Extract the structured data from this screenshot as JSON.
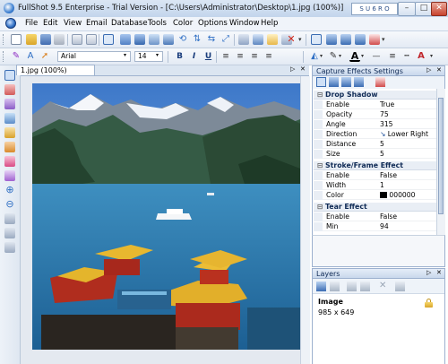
{
  "window": {
    "title": "FullShot 9.5 Enterprise - Trial Version - [C:\\Users\\Administrator\\Desktop\\1.jpg (100%)]",
    "controls": {
      "sys_box": "S U 6 R O",
      "minimize": "–",
      "maximize": "□",
      "close": "✕"
    }
  },
  "menu": [
    "File",
    "Edit",
    "View",
    "Email",
    "Database",
    "Tools",
    "Color",
    "Options",
    "Window",
    "Help"
  ],
  "format_bar": {
    "font": "Arial",
    "size": "14",
    "bold": "B",
    "italic": "I",
    "underline": "U"
  },
  "document": {
    "tab_label": "1.jpg (100%)",
    "pin": "▷",
    "close": "✕"
  },
  "capture_effects": {
    "title": "Capture Effects Settings",
    "pin": "▷",
    "close": "✕",
    "groups": [
      {
        "toggle": "⊟",
        "name": "Drop Shadow",
        "rows": [
          {
            "name": "Enable",
            "value": "True"
          },
          {
            "name": "Opacity",
            "value": "75"
          },
          {
            "name": "Angle",
            "value": "315"
          },
          {
            "name": "Direction",
            "value": "Lower Right",
            "icon": "↘"
          },
          {
            "name": "Distance",
            "value": "5"
          },
          {
            "name": "Size",
            "value": "5"
          }
        ]
      },
      {
        "toggle": "⊟",
        "name": "Stroke/Frame Effect",
        "rows": [
          {
            "name": "Enable",
            "value": "False"
          },
          {
            "name": "Width",
            "value": "1"
          },
          {
            "name": "Color",
            "value": "000000",
            "swatch": "#000000"
          }
        ]
      },
      {
        "toggle": "⊟",
        "name": "Tear Effect",
        "rows": [
          {
            "name": "Enable",
            "value": "False"
          },
          {
            "name": "Min",
            "value": "94"
          }
        ]
      }
    ]
  },
  "layers": {
    "title": "Layers",
    "pin": "▷",
    "close": "✕",
    "item": {
      "name": "Image",
      "size": "985 x 649",
      "lock_icon": "lock-icon"
    }
  },
  "colors": {
    "accent": "#2f6fc4",
    "panel_header": "#c9d8ec",
    "title_bar": "#c3d5ec",
    "close_red": "#c8422d"
  }
}
